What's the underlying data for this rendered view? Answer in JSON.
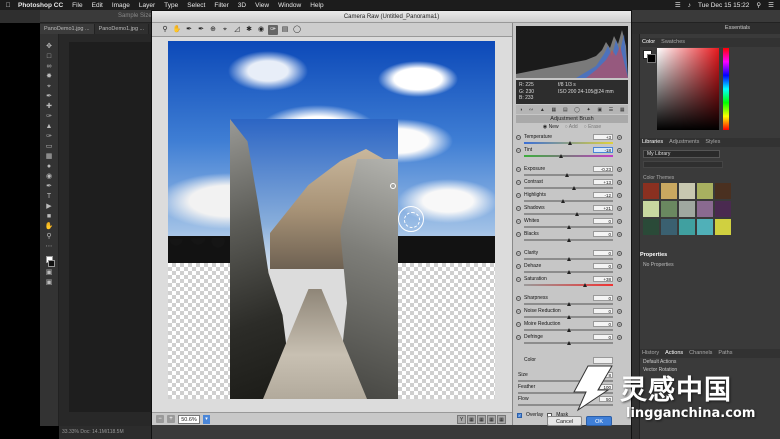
{
  "menubar": {
    "app_name": "Photoshop CC",
    "items": [
      "File",
      "Edit",
      "Image",
      "Layer",
      "Type",
      "Select",
      "Filter",
      "3D",
      "View",
      "Window",
      "Help"
    ],
    "clock": "Tue Dec 15  15:22"
  },
  "ps": {
    "sample_label": "Sample Size",
    "tabs": [
      "PanoDemo1.jpg ...",
      "PanoDemo1.jpg ..."
    ],
    "status_text": "33.33%     Doc: 14.1M/118.5M",
    "workspace": "Essentials",
    "color_panel_tabs": [
      "Color",
      "Swatches"
    ],
    "library_tabs": [
      "Libraries",
      "Adjustments",
      "Styles"
    ],
    "library_select": "My Library",
    "library_section": "Color Themes",
    "properties_tabs": [
      "Properties"
    ],
    "properties_body": "No Properties",
    "bottom_tabs": [
      "History",
      "Actions",
      "Channels",
      "Paths"
    ],
    "actions": [
      "Default Actions",
      "Vector Rotation"
    ],
    "swatch_colors": [
      "#8a3020",
      "#c9a860",
      "#c8c8b0",
      "#a8b060",
      "#4a3020",
      "#c8d8a0",
      "#6a8860",
      "#a0a8a0",
      "#8a6a90",
      "#4a2a50",
      "#2a4a38",
      "#3a6070",
      "#40a0a0",
      "#50b0b8",
      "#d0d040"
    ]
  },
  "camera_raw": {
    "title": "Camera Raw (Untitled_Panorama1)",
    "zoom": "50.6%",
    "readout": {
      "r": "R:   225",
      "g": "G:   230",
      "b": "B:   233",
      "exif1": "f/8       1/3 s",
      "exif2": "ISO 200   24-105@24 mm"
    },
    "adjustment_title": "Adjustment Brush",
    "modes": [
      "New",
      "Add",
      "Erase"
    ],
    "sliders": [
      {
        "label": "Temperature",
        "value": "+3",
        "pos": 0.52,
        "track": "temp",
        "gap": false
      },
      {
        "label": "Tint",
        "value": "-18",
        "pos": 0.42,
        "track": "tint",
        "gap": false,
        "highlight": true
      },
      {
        "label": "Exposure",
        "value": "-0.23",
        "pos": 0.48,
        "track": "",
        "gap": true
      },
      {
        "label": "Contrast",
        "value": "+13",
        "pos": 0.56,
        "track": "",
        "gap": false
      },
      {
        "label": "Highlights",
        "value": "-12",
        "pos": 0.44,
        "track": "",
        "gap": false
      },
      {
        "label": "Shadows",
        "value": "+21",
        "pos": 0.6,
        "track": "",
        "gap": false
      },
      {
        "label": "Whites",
        "value": "0",
        "pos": 0.5,
        "track": "",
        "gap": false
      },
      {
        "label": "Blacks",
        "value": "0",
        "pos": 0.5,
        "track": "",
        "gap": false
      },
      {
        "label": "Clarity",
        "value": "0",
        "pos": 0.5,
        "track": "",
        "gap": true
      },
      {
        "label": "Dehaze",
        "value": "0",
        "pos": 0.5,
        "track": "",
        "gap": false
      },
      {
        "label": "Saturation",
        "value": "+38",
        "pos": 0.69,
        "track": "sat",
        "gap": false
      },
      {
        "label": "Sharpness",
        "value": "0",
        "pos": 0.5,
        "track": "",
        "gap": true
      },
      {
        "label": "Noise Reduction",
        "value": "0",
        "pos": 0.5,
        "track": "",
        "gap": false
      },
      {
        "label": "Moire Reduction",
        "value": "0",
        "pos": 0.5,
        "track": "",
        "gap": false
      },
      {
        "label": "Defringe",
        "value": "0",
        "pos": 0.5,
        "track": "",
        "gap": false
      }
    ],
    "color_label": "Color",
    "brush": [
      {
        "label": "Size",
        "value": "8"
      },
      {
        "label": "Feather",
        "value": "100"
      },
      {
        "label": "Flow",
        "value": "50"
      }
    ],
    "overlay_label": "Overlay",
    "mask_label": "Mask",
    "cancel_label": "Cancel",
    "ok_label": "OK"
  },
  "watermark": {
    "title": "灵感中国",
    "url": "lingganchina.com"
  }
}
